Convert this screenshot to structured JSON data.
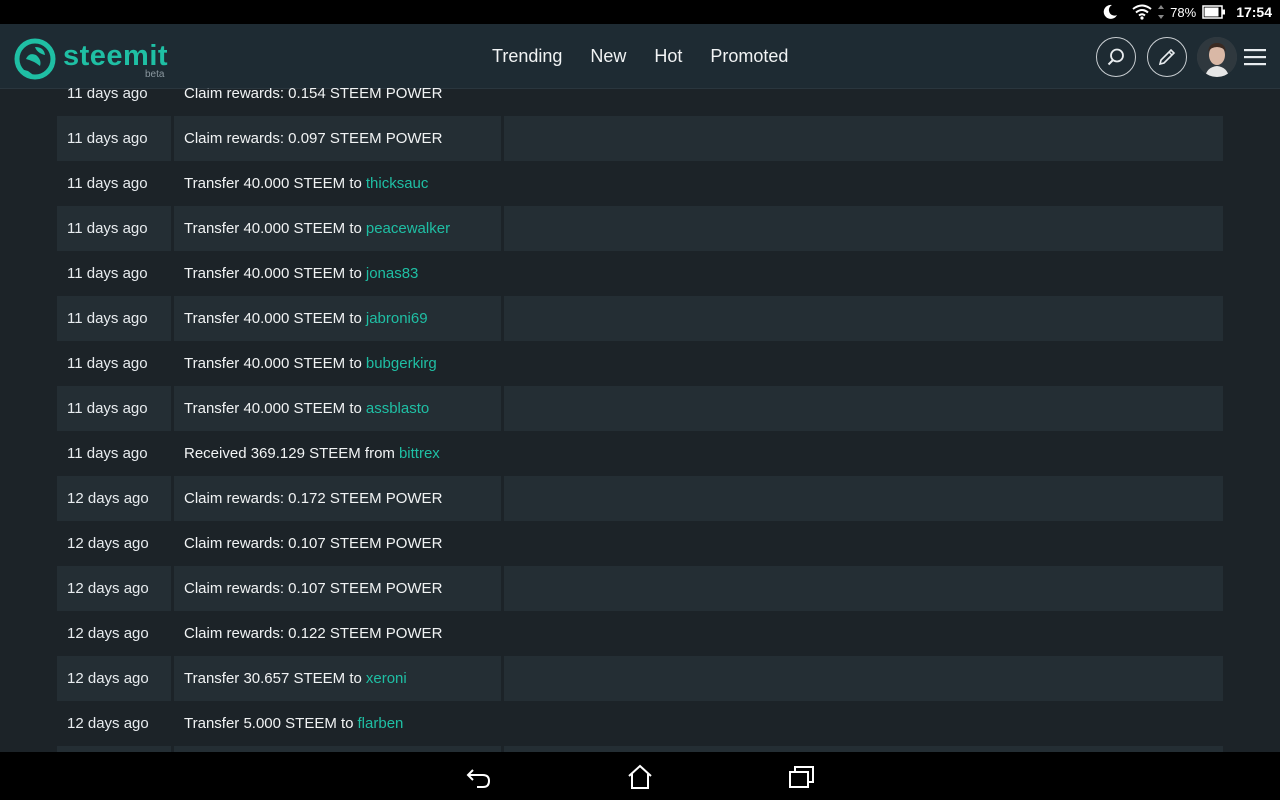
{
  "status_bar": {
    "battery": "78%",
    "time": "17:54"
  },
  "header": {
    "logo_text": "steemit",
    "logo_beta": "beta",
    "nav": [
      "Trending",
      "New",
      "Hot",
      "Promoted"
    ]
  },
  "rows": [
    {
      "date": "11 days ago",
      "text": "Claim rewards: 0.154 STEEM POWER",
      "link": ""
    },
    {
      "date": "11 days ago",
      "text": "Claim rewards: 0.097 STEEM POWER",
      "link": ""
    },
    {
      "date": "11 days ago",
      "text": "Transfer 40.000 STEEM to",
      "link": "thicksauc"
    },
    {
      "date": "11 days ago",
      "text": "Transfer 40.000 STEEM to",
      "link": "peacewalker"
    },
    {
      "date": "11 days ago",
      "text": "Transfer 40.000 STEEM to",
      "link": "jonas83"
    },
    {
      "date": "11 days ago",
      "text": "Transfer 40.000 STEEM to",
      "link": "jabroni69"
    },
    {
      "date": "11 days ago",
      "text": "Transfer 40.000 STEEM to",
      "link": "bubgerkirg"
    },
    {
      "date": "11 days ago",
      "text": "Transfer 40.000 STEEM to",
      "link": "assblasto"
    },
    {
      "date": "11 days ago",
      "text": "Received 369.129 STEEM from",
      "link": "bittrex"
    },
    {
      "date": "12 days ago",
      "text": "Claim rewards: 0.172 STEEM POWER",
      "link": ""
    },
    {
      "date": "12 days ago",
      "text": "Claim rewards: 0.107 STEEM POWER",
      "link": ""
    },
    {
      "date": "12 days ago",
      "text": "Claim rewards: 0.107 STEEM POWER",
      "link": ""
    },
    {
      "date": "12 days ago",
      "text": "Claim rewards: 0.122 STEEM POWER",
      "link": ""
    },
    {
      "date": "12 days ago",
      "text": "Transfer 30.657 STEEM to",
      "link": "xeroni"
    },
    {
      "date": "12 days ago",
      "text": "Transfer 5.000 STEEM to",
      "link": "flarben"
    },
    {
      "date": "",
      "text": "",
      "link": ""
    }
  ],
  "icons": {
    "status": [
      "moon-icon",
      "wifi-icon",
      "battery-icon"
    ],
    "header": [
      "search-icon",
      "edit-icon",
      "avatar",
      "menu-icon"
    ],
    "navbar": [
      "back-icon",
      "home-icon",
      "recent-apps-icon"
    ]
  },
  "colors": {
    "accent": "#1fbfa4",
    "background": "#1c2328",
    "header": "#1e2b33",
    "row_shade": "#242e34"
  }
}
